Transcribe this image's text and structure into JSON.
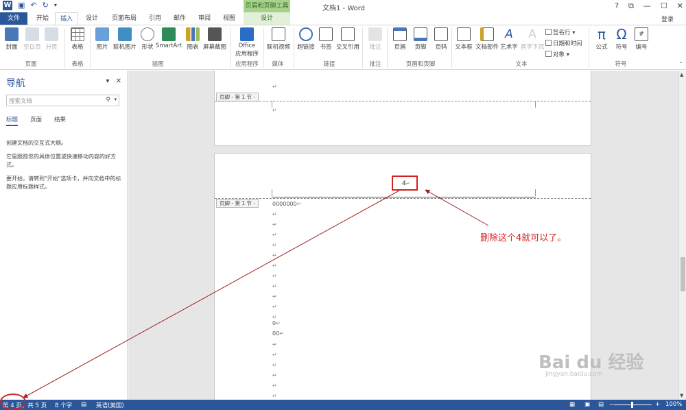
{
  "titlebar": {
    "logo": "W",
    "save_icon": "save-icon",
    "undo_icon": "undo-icon",
    "redo_icon": "redo-icon",
    "context_tools": "页眉和页脚工具",
    "doc_title": "文档1 - Word",
    "help": "?",
    "restore": "⧉",
    "minimize": "—",
    "maximize": "☐",
    "close": "✕"
  },
  "tabs": {
    "file": "文件",
    "home": "开始",
    "insert": "插入",
    "design": "设计",
    "layout": "页面布局",
    "references": "引用",
    "mailings": "邮件",
    "review": "审阅",
    "view": "视图",
    "hf_design": "设计",
    "login": "登录"
  },
  "ribbon": {
    "cover": "封面",
    "blank_page": "空白页",
    "page_break": "分页",
    "group_pages": "页面",
    "table": "表格",
    "group_tables": "表格",
    "picture": "图片",
    "online_picture": "联机图片",
    "shapes": "形状",
    "smartart": "SmartArt",
    "chart": "图表",
    "screenshot": "屏幕截图",
    "group_illustrations": "插图",
    "office_apps_1": "Office",
    "office_apps_2": "应用程序",
    "group_apps": "应用程序",
    "online_video": "联机视频",
    "group_media": "媒体",
    "hyperlink": "超链接",
    "bookmark": "书签",
    "cross_ref": "交叉引用",
    "group_links": "链接",
    "comment": "批注",
    "group_comments": "批注",
    "header": "页眉",
    "footer": "页脚",
    "page_number": "页码",
    "group_hf": "页眉和页脚",
    "textbox": "文本框",
    "quick_parts": "文档部件",
    "wordart": "艺术字",
    "dropcap": "首字下沉",
    "signature_line": "签名行",
    "date_time": "日期和时间",
    "object": "对象",
    "group_text": "文本",
    "equation": "公式",
    "symbol": "符号",
    "numbering": "编号",
    "group_symbols": "符号"
  },
  "nav": {
    "title": "导航",
    "search_placeholder": "搜索文档",
    "tab_headings": "标题",
    "tab_pages": "页面",
    "tab_results": "结果",
    "text1": "创建文档的交互式大纲。",
    "text2": "它是跟踪您的具体位置或快速移动内容的好方式。",
    "text3": "要开始，请转到\"开始\"选项卡，并向文档中的标题应用标题样式。"
  },
  "document": {
    "footer_label": "页脚 - 第 1 节 -",
    "para_mark": "↵",
    "page_number": "4",
    "line_1": "0000000",
    "line_2": "0",
    "line_3": "00"
  },
  "annotation": {
    "text": "删除这个4就可以了。",
    "color": "#d42020"
  },
  "watermark": {
    "logo": "Bai du 经验",
    "url": "jingyan.baidu.com"
  },
  "statusbar": {
    "page": "第 4 页，共 5 页",
    "words": "8 个字",
    "language": "英语(美国)",
    "zoom": "100%",
    "zoom_minus": "−",
    "zoom_plus": "+"
  },
  "colors": {
    "accent": "#2b579a",
    "context_green": "#a9d18e",
    "annotation_red": "#d42020"
  }
}
